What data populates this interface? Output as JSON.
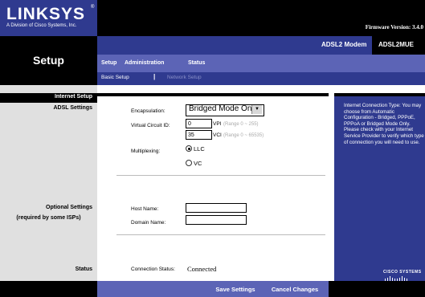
{
  "header": {
    "logo_text": "LINKSYS",
    "logo_registered": "®",
    "logo_subtitle": "A Division of Cisco Systems, Inc.",
    "firmware": "Firmware Version: 3.4.0"
  },
  "nav": {
    "section_title": "Setup",
    "model_label": "ADSL2 Modem",
    "model_name": "ADSL2MUE",
    "tabs": [
      {
        "label": "Setup"
      },
      {
        "label": "Administration"
      },
      {
        "label": "Status"
      }
    ],
    "subtabs": [
      {
        "label": "Basic Setup"
      },
      {
        "label": "Network Setup"
      }
    ],
    "separator": "|"
  },
  "sidebar": {
    "internet_setup": "Internet Setup",
    "adsl_settings": "ADSL Settings",
    "optional_settings": "Optional Settings",
    "required_note": "(required by some ISPs)",
    "status": "Status"
  },
  "form": {
    "encapsulation_label": "Encapsulation:",
    "encapsulation_value": "Bridged Mode Only",
    "vc_id_label": "Virtual Circuit ID:",
    "vpi_value": "0",
    "vpi_label": "VPI",
    "vpi_range": "(Range 0 ~ 255)",
    "vci_value": "35",
    "vci_label": "VCI",
    "vci_range": "(Range 0 ~ 65535)",
    "multiplexing_label": "Multiplexing:",
    "llc_label": "LLC",
    "vc_label": "VC",
    "host_name_label": "Host Name:",
    "host_name_value": "",
    "domain_name_label": "Domain Name:",
    "domain_name_value": "",
    "connection_status_label": "Connection Status:",
    "connection_status_value": "Connected"
  },
  "help": {
    "text": "Internet Connection Type: You may choose from Automatic Configuration - Bridged, PPPoE, PPPoA or Bridged Mode Only. Please check with your Internet Service Provider to verify which type of connection you will need to use.",
    "brand": "CISCO SYSTEMS"
  },
  "buttons": {
    "save": "Save Settings",
    "cancel": "Cancel Changes"
  },
  "colors": {
    "brand_blue": "#2f3a8f",
    "nav_light": "#5c64b6",
    "black": "#000000"
  }
}
